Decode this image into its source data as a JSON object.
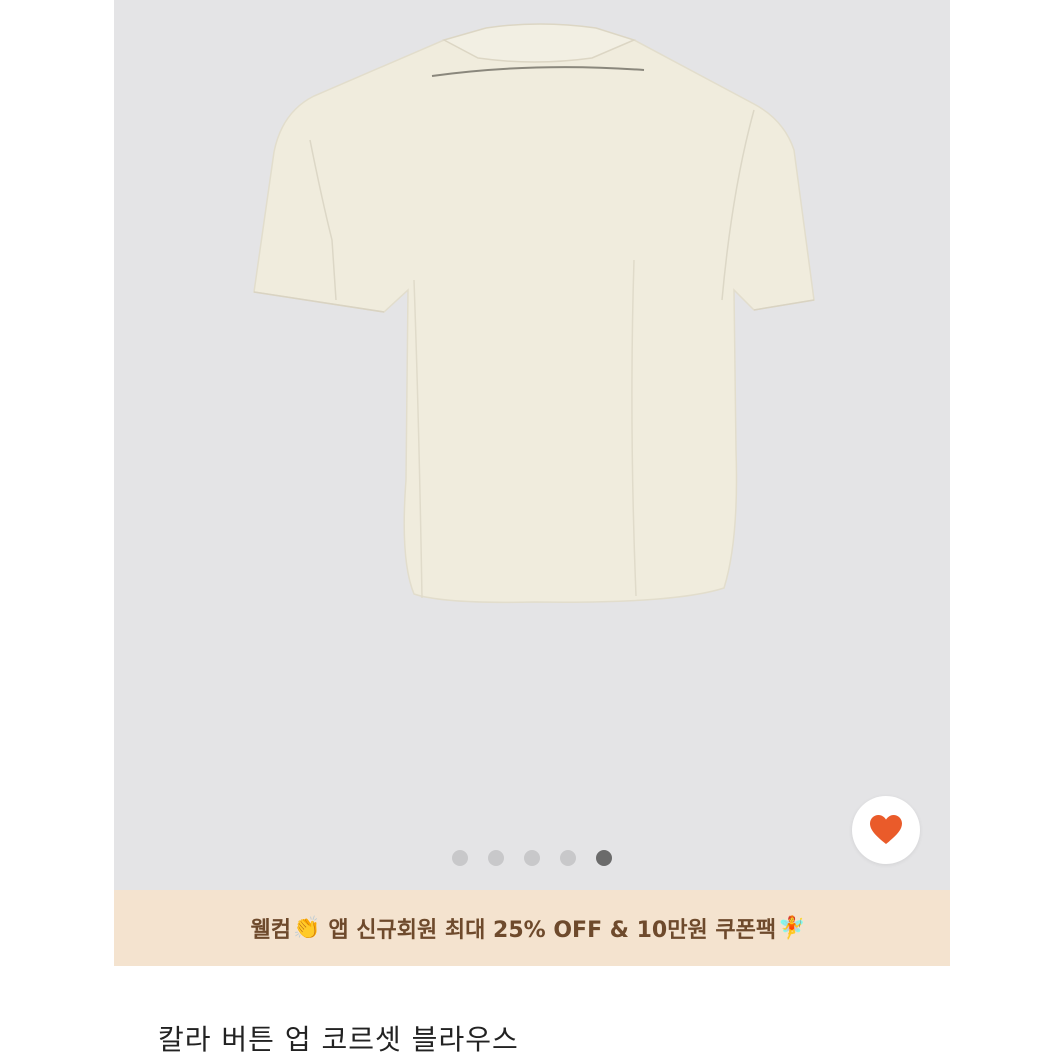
{
  "gallery": {
    "background": "#e4e4e6",
    "image_alt": "cream collar button-up corset blouse back view",
    "dots_total": 5,
    "dots_active_index": 4
  },
  "wishlist": {
    "icon": "heart-icon",
    "color": "#ea5b2a"
  },
  "promo": {
    "text_before": "웰컴",
    "clap_emoji": "👏",
    "text_main": "앱 신규회원 최대 25% OFF & 10만원 쿠폰팩",
    "fairy_emoji": "🧚",
    "background": "#f4e3cf",
    "text_color": "#6e4a2c"
  },
  "product": {
    "title": "칼라 버튼 업 코르셋 블라우스"
  }
}
